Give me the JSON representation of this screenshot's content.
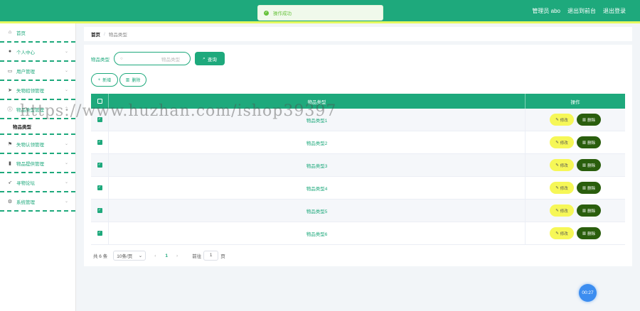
{
  "topbar": {
    "admin": "管理员 abo",
    "back_home": "退出到前台",
    "logout": "退出登录"
  },
  "toast": {
    "message": "操作成功"
  },
  "sidebar": {
    "items": [
      {
        "label": "首页",
        "icon": "home-icon"
      },
      {
        "label": "个人中心",
        "icon": "user-icon"
      },
      {
        "label": "用户管理",
        "icon": "folder-icon"
      },
      {
        "label": "失物招领管理",
        "icon": "send-icon"
      },
      {
        "label": "物品类型管理",
        "icon": "info-icon"
      },
      {
        "label": "失物认领管理",
        "icon": "flag-icon"
      },
      {
        "label": "物品提供管理",
        "icon": "chart-icon"
      },
      {
        "label": "寻物论坛",
        "icon": "navigation-icon"
      },
      {
        "label": "系统管理",
        "icon": "settings-icon"
      }
    ],
    "sub_item": "物品类型"
  },
  "breadcrumb": {
    "home": "首页",
    "sep": "/",
    "current": "物品类型"
  },
  "search": {
    "label": "物品类型",
    "placeholder": "物品类型",
    "query_label": "查询"
  },
  "actions": {
    "add_label": "新增",
    "delete_label": "删除"
  },
  "table": {
    "headers": {
      "type": "物品类型",
      "op": "操作"
    },
    "rows": [
      {
        "type": "物品类型1"
      },
      {
        "type": "物品类型2"
      },
      {
        "type": "物品类型3"
      },
      {
        "type": "物品类型4"
      },
      {
        "type": "物品类型5"
      },
      {
        "type": "物品类型6"
      }
    ],
    "edit_label": "修改",
    "remove_label": "删除"
  },
  "pager": {
    "total": "共 6 条",
    "page_size": "10条/页",
    "page": "1",
    "goto": "前往",
    "goto_value": "1",
    "unit": "页"
  },
  "float": {
    "time": "00:27"
  },
  "watermark": "https://www.huzhan.com/ishop39397",
  "colors": {
    "primary": "#1ea97c",
    "accent": "#e5f95f",
    "edit": "#f6f757",
    "delete": "#2a5e0d"
  }
}
